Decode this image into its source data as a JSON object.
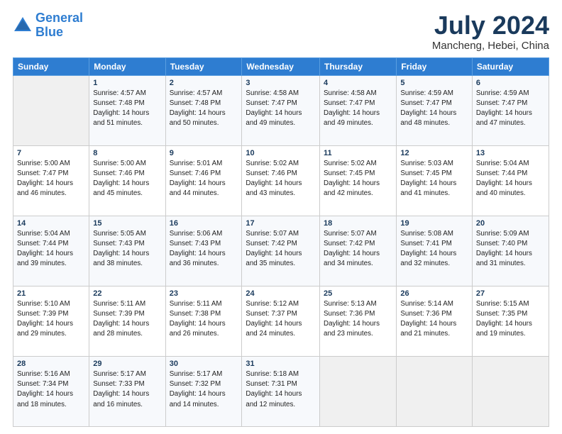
{
  "header": {
    "logo_line1": "General",
    "logo_line2": "Blue",
    "title": "July 2024",
    "subtitle": "Mancheng, Hebei, China"
  },
  "weekdays": [
    "Sunday",
    "Monday",
    "Tuesday",
    "Wednesday",
    "Thursday",
    "Friday",
    "Saturday"
  ],
  "weeks": [
    [
      {
        "day": "",
        "info": ""
      },
      {
        "day": "1",
        "info": "Sunrise: 4:57 AM\nSunset: 7:48 PM\nDaylight: 14 hours\nand 51 minutes."
      },
      {
        "day": "2",
        "info": "Sunrise: 4:57 AM\nSunset: 7:48 PM\nDaylight: 14 hours\nand 50 minutes."
      },
      {
        "day": "3",
        "info": "Sunrise: 4:58 AM\nSunset: 7:47 PM\nDaylight: 14 hours\nand 49 minutes."
      },
      {
        "day": "4",
        "info": "Sunrise: 4:58 AM\nSunset: 7:47 PM\nDaylight: 14 hours\nand 49 minutes."
      },
      {
        "day": "5",
        "info": "Sunrise: 4:59 AM\nSunset: 7:47 PM\nDaylight: 14 hours\nand 48 minutes."
      },
      {
        "day": "6",
        "info": "Sunrise: 4:59 AM\nSunset: 7:47 PM\nDaylight: 14 hours\nand 47 minutes."
      }
    ],
    [
      {
        "day": "7",
        "info": "Sunrise: 5:00 AM\nSunset: 7:47 PM\nDaylight: 14 hours\nand 46 minutes."
      },
      {
        "day": "8",
        "info": "Sunrise: 5:00 AM\nSunset: 7:46 PM\nDaylight: 14 hours\nand 45 minutes."
      },
      {
        "day": "9",
        "info": "Sunrise: 5:01 AM\nSunset: 7:46 PM\nDaylight: 14 hours\nand 44 minutes."
      },
      {
        "day": "10",
        "info": "Sunrise: 5:02 AM\nSunset: 7:46 PM\nDaylight: 14 hours\nand 43 minutes."
      },
      {
        "day": "11",
        "info": "Sunrise: 5:02 AM\nSunset: 7:45 PM\nDaylight: 14 hours\nand 42 minutes."
      },
      {
        "day": "12",
        "info": "Sunrise: 5:03 AM\nSunset: 7:45 PM\nDaylight: 14 hours\nand 41 minutes."
      },
      {
        "day": "13",
        "info": "Sunrise: 5:04 AM\nSunset: 7:44 PM\nDaylight: 14 hours\nand 40 minutes."
      }
    ],
    [
      {
        "day": "14",
        "info": "Sunrise: 5:04 AM\nSunset: 7:44 PM\nDaylight: 14 hours\nand 39 minutes."
      },
      {
        "day": "15",
        "info": "Sunrise: 5:05 AM\nSunset: 7:43 PM\nDaylight: 14 hours\nand 38 minutes."
      },
      {
        "day": "16",
        "info": "Sunrise: 5:06 AM\nSunset: 7:43 PM\nDaylight: 14 hours\nand 36 minutes."
      },
      {
        "day": "17",
        "info": "Sunrise: 5:07 AM\nSunset: 7:42 PM\nDaylight: 14 hours\nand 35 minutes."
      },
      {
        "day": "18",
        "info": "Sunrise: 5:07 AM\nSunset: 7:42 PM\nDaylight: 14 hours\nand 34 minutes."
      },
      {
        "day": "19",
        "info": "Sunrise: 5:08 AM\nSunset: 7:41 PM\nDaylight: 14 hours\nand 32 minutes."
      },
      {
        "day": "20",
        "info": "Sunrise: 5:09 AM\nSunset: 7:40 PM\nDaylight: 14 hours\nand 31 minutes."
      }
    ],
    [
      {
        "day": "21",
        "info": "Sunrise: 5:10 AM\nSunset: 7:39 PM\nDaylight: 14 hours\nand 29 minutes."
      },
      {
        "day": "22",
        "info": "Sunrise: 5:11 AM\nSunset: 7:39 PM\nDaylight: 14 hours\nand 28 minutes."
      },
      {
        "day": "23",
        "info": "Sunrise: 5:11 AM\nSunset: 7:38 PM\nDaylight: 14 hours\nand 26 minutes."
      },
      {
        "day": "24",
        "info": "Sunrise: 5:12 AM\nSunset: 7:37 PM\nDaylight: 14 hours\nand 24 minutes."
      },
      {
        "day": "25",
        "info": "Sunrise: 5:13 AM\nSunset: 7:36 PM\nDaylight: 14 hours\nand 23 minutes."
      },
      {
        "day": "26",
        "info": "Sunrise: 5:14 AM\nSunset: 7:36 PM\nDaylight: 14 hours\nand 21 minutes."
      },
      {
        "day": "27",
        "info": "Sunrise: 5:15 AM\nSunset: 7:35 PM\nDaylight: 14 hours\nand 19 minutes."
      }
    ],
    [
      {
        "day": "28",
        "info": "Sunrise: 5:16 AM\nSunset: 7:34 PM\nDaylight: 14 hours\nand 18 minutes."
      },
      {
        "day": "29",
        "info": "Sunrise: 5:17 AM\nSunset: 7:33 PM\nDaylight: 14 hours\nand 16 minutes."
      },
      {
        "day": "30",
        "info": "Sunrise: 5:17 AM\nSunset: 7:32 PM\nDaylight: 14 hours\nand 14 minutes."
      },
      {
        "day": "31",
        "info": "Sunrise: 5:18 AM\nSunset: 7:31 PM\nDaylight: 14 hours\nand 12 minutes."
      },
      {
        "day": "",
        "info": ""
      },
      {
        "day": "",
        "info": ""
      },
      {
        "day": "",
        "info": ""
      }
    ]
  ]
}
